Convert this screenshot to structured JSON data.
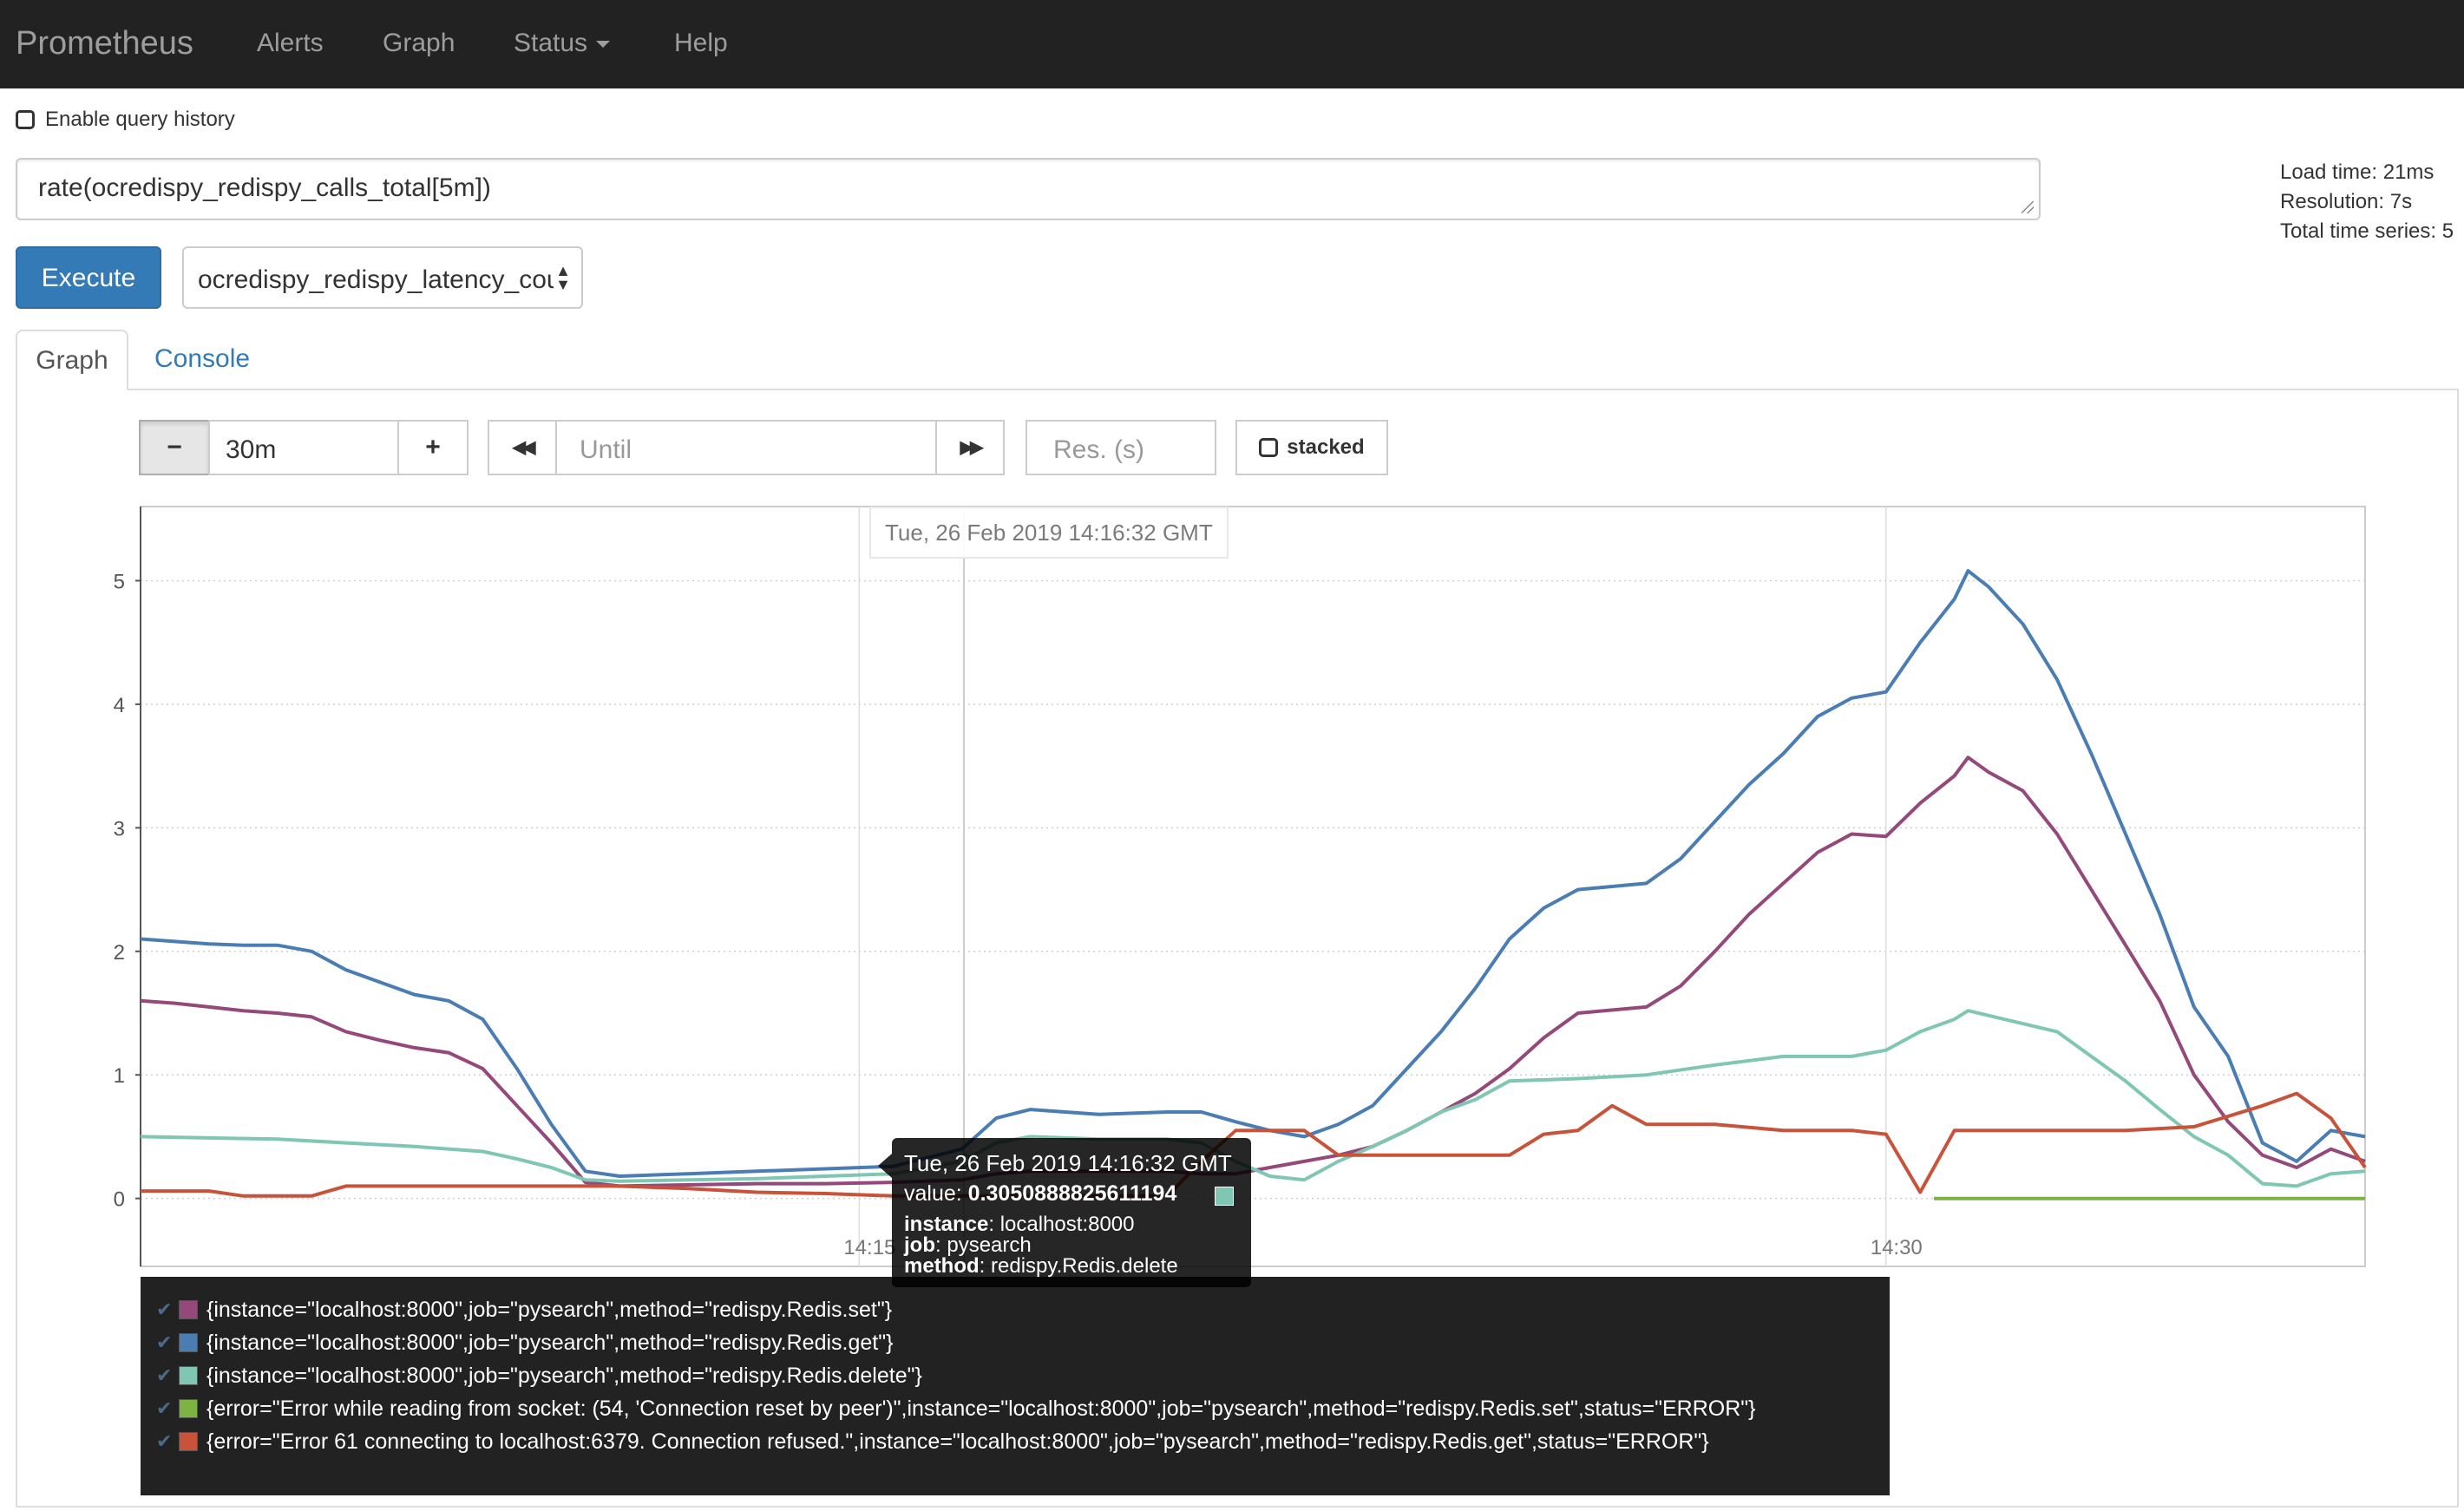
{
  "navbar": {
    "brand": "Prometheus",
    "links": [
      "Alerts",
      "Graph",
      "Status",
      "Help"
    ]
  },
  "query": {
    "history_label": "Enable query history",
    "expression": "rate(ocredispy_redispy_calls_total[5m])",
    "execute_label": "Execute",
    "metric_select_value": "ocredispy_redispy_latency_count"
  },
  "stats": {
    "load_time": "Load time: 21ms",
    "resolution": "Resolution: 7s",
    "total_series": "Total time series: 5"
  },
  "tabs": {
    "graph": "Graph",
    "console": "Console"
  },
  "controls": {
    "minus": "−",
    "range": "30m",
    "plus": "+",
    "back": "◀◀",
    "until_placeholder": "Until",
    "forward": "▶▶",
    "res_placeholder": "Res. (s)",
    "stacked_label": "stacked"
  },
  "hover_time_label": "Tue, 26 Feb 2019 14:16:32 GMT",
  "tooltip": {
    "time": "Tue, 26 Feb 2019 14:16:32 GMT",
    "value_label": "value:",
    "value": "0.3050888825611194",
    "instance_label": "instance",
    "instance": "localhost:8000",
    "job_label": "job",
    "job": "pysearch",
    "method_label": "method",
    "method": "redispy.Redis.delete"
  },
  "legend": [
    {
      "text": "{instance=\"localhost:8000\",job=\"pysearch\",method=\"redispy.Redis.set\"}",
      "color": "#94497a"
    },
    {
      "text": "{instance=\"localhost:8000\",job=\"pysearch\",method=\"redispy.Redis.get\"}",
      "color": "#4a7db3"
    },
    {
      "text": "{instance=\"localhost:8000\",job=\"pysearch\",method=\"redispy.Redis.delete\"}",
      "color": "#7fc6b3"
    },
    {
      "text": "{error=\"Error while reading from socket: (54, 'Connection reset by peer')\",instance=\"localhost:8000\",job=\"pysearch\",method=\"redispy.Redis.set\",status=\"ERROR\"}",
      "color": "#7cb342"
    },
    {
      "text": "{error=\"Error 61 connecting to localhost:6379. Connection refused.\",instance=\"localhost:8000\",job=\"pysearch\",method=\"redispy.Redis.get\",status=\"ERROR\"}",
      "color": "#c8533a"
    }
  ],
  "chart_data": {
    "type": "line",
    "title": "",
    "xlabel": "",
    "ylabel": "",
    "x_unit": "minutes since 14:04:30",
    "x_ticks": [
      {
        "x": 10.5,
        "label": "14:15"
      },
      {
        "x": 25.5,
        "label": "14:30"
      }
    ],
    "y_ticks": [
      0,
      1,
      2,
      3,
      4,
      5
    ],
    "xlim": [
      0,
      30
    ],
    "ylim": [
      -0.55,
      5.6
    ],
    "hover_x": 12.03,
    "grid": true,
    "series": [
      {
        "name": "{instance=\"localhost:8000\",job=\"pysearch\",method=\"redispy.Redis.set\"}",
        "color": "#94497a",
        "points": [
          [
            0,
            1.6
          ],
          [
            0.5,
            1.58
          ],
          [
            1,
            1.55
          ],
          [
            1.5,
            1.52
          ],
          [
            2,
            1.5
          ],
          [
            2.5,
            1.47
          ],
          [
            3,
            1.35
          ],
          [
            3.5,
            1.28
          ],
          [
            4,
            1.22
          ],
          [
            4.5,
            1.18
          ],
          [
            5,
            1.05
          ],
          [
            5.5,
            0.75
          ],
          [
            6,
            0.45
          ],
          [
            6.5,
            0.13
          ],
          [
            7,
            0.1
          ],
          [
            8,
            0.11
          ],
          [
            9,
            0.12
          ],
          [
            10,
            0.12
          ],
          [
            11,
            0.13
          ],
          [
            12,
            0.15
          ],
          [
            12.5,
            0.2
          ],
          [
            13,
            0.22
          ],
          [
            14,
            0.22
          ],
          [
            15,
            0.22
          ],
          [
            15.5,
            0.2
          ],
          [
            16,
            0.2
          ],
          [
            16.5,
            0.25
          ],
          [
            17,
            0.3
          ],
          [
            17.5,
            0.35
          ],
          [
            18,
            0.42
          ],
          [
            18.5,
            0.55
          ],
          [
            19,
            0.7
          ],
          [
            19.5,
            0.85
          ],
          [
            20,
            1.05
          ],
          [
            20.5,
            1.3
          ],
          [
            21,
            1.5
          ],
          [
            22,
            1.55
          ],
          [
            22.5,
            1.72
          ],
          [
            23,
            2.0
          ],
          [
            23.5,
            2.3
          ],
          [
            24,
            2.55
          ],
          [
            24.5,
            2.8
          ],
          [
            25,
            2.95
          ],
          [
            25.5,
            2.93
          ],
          [
            26,
            3.2
          ],
          [
            26.5,
            3.42
          ],
          [
            26.7,
            3.57
          ],
          [
            27,
            3.45
          ],
          [
            27.5,
            3.3
          ],
          [
            28,
            2.95
          ],
          [
            28.5,
            2.5
          ],
          [
            29,
            2.05
          ],
          [
            29.5,
            1.6
          ],
          [
            30,
            1.0
          ],
          [
            30.5,
            0.62
          ],
          [
            31,
            0.35
          ],
          [
            31.5,
            0.25
          ],
          [
            32,
            0.4
          ],
          [
            32.5,
            0.3
          ]
        ]
      },
      {
        "name": "{instance=\"localhost:8000\",job=\"pysearch\",method=\"redispy.Redis.get\"}",
        "color": "#4a7db3",
        "points": [
          [
            0,
            2.1
          ],
          [
            0.5,
            2.08
          ],
          [
            1,
            2.06
          ],
          [
            1.5,
            2.05
          ],
          [
            2,
            2.05
          ],
          [
            2.5,
            2.0
          ],
          [
            3,
            1.85
          ],
          [
            3.5,
            1.75
          ],
          [
            4,
            1.65
          ],
          [
            4.5,
            1.6
          ],
          [
            5,
            1.45
          ],
          [
            5.5,
            1.05
          ],
          [
            6,
            0.6
          ],
          [
            6.5,
            0.22
          ],
          [
            7,
            0.18
          ],
          [
            8,
            0.2
          ],
          [
            9,
            0.22
          ],
          [
            10,
            0.24
          ],
          [
            11,
            0.26
          ],
          [
            12,
            0.4
          ],
          [
            12.5,
            0.65
          ],
          [
            13,
            0.72
          ],
          [
            14,
            0.68
          ],
          [
            15,
            0.7
          ],
          [
            15.5,
            0.7
          ],
          [
            16,
            0.62
          ],
          [
            16.5,
            0.55
          ],
          [
            17,
            0.5
          ],
          [
            17.5,
            0.6
          ],
          [
            18,
            0.75
          ],
          [
            18.5,
            1.05
          ],
          [
            19,
            1.35
          ],
          [
            19.5,
            1.7
          ],
          [
            20,
            2.1
          ],
          [
            20.5,
            2.35
          ],
          [
            21,
            2.5
          ],
          [
            22,
            2.55
          ],
          [
            22.5,
            2.75
          ],
          [
            23,
            3.05
          ],
          [
            23.5,
            3.35
          ],
          [
            24,
            3.6
          ],
          [
            24.5,
            3.9
          ],
          [
            25,
            4.05
          ],
          [
            25.5,
            4.1
          ],
          [
            26,
            4.5
          ],
          [
            26.5,
            4.85
          ],
          [
            26.7,
            5.08
          ],
          [
            27,
            4.95
          ],
          [
            27.5,
            4.65
          ],
          [
            28,
            4.2
          ],
          [
            28.5,
            3.6
          ],
          [
            29,
            2.95
          ],
          [
            29.5,
            2.3
          ],
          [
            30,
            1.55
          ],
          [
            30.5,
            1.15
          ],
          [
            31,
            0.45
          ],
          [
            31.5,
            0.3
          ],
          [
            32,
            0.55
          ],
          [
            32.5,
            0.5
          ]
        ]
      },
      {
        "name": "{instance=\"localhost:8000\",job=\"pysearch\",method=\"redispy.Redis.delete\"}",
        "color": "#7fc6b3",
        "points": [
          [
            0,
            0.5
          ],
          [
            1,
            0.49
          ],
          [
            2,
            0.48
          ],
          [
            3,
            0.45
          ],
          [
            4,
            0.42
          ],
          [
            5,
            0.38
          ],
          [
            5.5,
            0.32
          ],
          [
            6,
            0.25
          ],
          [
            6.5,
            0.15
          ],
          [
            7,
            0.14
          ],
          [
            8,
            0.15
          ],
          [
            9,
            0.16
          ],
          [
            10,
            0.18
          ],
          [
            11,
            0.2
          ],
          [
            12,
            0.3
          ],
          [
            12.5,
            0.45
          ],
          [
            13,
            0.5
          ],
          [
            14,
            0.48
          ],
          [
            15,
            0.48
          ],
          [
            15.5,
            0.45
          ],
          [
            16,
            0.3
          ],
          [
            16.5,
            0.18
          ],
          [
            17,
            0.15
          ],
          [
            17.5,
            0.3
          ],
          [
            18,
            0.42
          ],
          [
            18.5,
            0.55
          ],
          [
            19,
            0.7
          ],
          [
            19.5,
            0.8
          ],
          [
            20,
            0.95
          ],
          [
            21,
            0.97
          ],
          [
            22,
            1.0
          ],
          [
            23,
            1.08
          ],
          [
            24,
            1.15
          ],
          [
            25,
            1.15
          ],
          [
            25.5,
            1.2
          ],
          [
            26,
            1.35
          ],
          [
            26.5,
            1.45
          ],
          [
            26.7,
            1.52
          ],
          [
            27,
            1.48
          ],
          [
            28,
            1.35
          ],
          [
            28.5,
            1.15
          ],
          [
            29,
            0.95
          ],
          [
            29.5,
            0.72
          ],
          [
            30,
            0.5
          ],
          [
            30.5,
            0.35
          ],
          [
            31,
            0.12
          ],
          [
            31.5,
            0.1
          ],
          [
            32,
            0.2
          ],
          [
            32.5,
            0.22
          ]
        ]
      },
      {
        "name": "{error=\"Error while reading from socket: (54, 'Connection reset by peer')\",instance=\"localhost:8000\",job=\"pysearch\",method=\"redispy.Redis.set\",status=\"ERROR\"}",
        "color": "#7cb342",
        "points": [
          [
            26.2,
            0
          ],
          [
            32.5,
            0
          ]
        ]
      },
      {
        "name": "{error=\"Error 61 connecting to localhost:6379. Connection refused.\",instance=\"localhost:8000\",job=\"pysearch\",method=\"redispy.Redis.get\",status=\"ERROR\"}",
        "color": "#c8533a",
        "points": [
          [
            0,
            0.06
          ],
          [
            1,
            0.06
          ],
          [
            1.5,
            0.02
          ],
          [
            2.5,
            0.02
          ],
          [
            3,
            0.1
          ],
          [
            4,
            0.1
          ],
          [
            5,
            0.1
          ],
          [
            6,
            0.1
          ],
          [
            7,
            0.1
          ],
          [
            8,
            0.08
          ],
          [
            9,
            0.05
          ],
          [
            10,
            0.04
          ],
          [
            11,
            0.02
          ],
          [
            12,
            0.02
          ],
          [
            13,
            0.02
          ],
          [
            14,
            0.02
          ],
          [
            15,
            0.02
          ],
          [
            15.5,
            0.3
          ],
          [
            16,
            0.55
          ],
          [
            17,
            0.55
          ],
          [
            17.5,
            0.35
          ],
          [
            18,
            0.35
          ],
          [
            19,
            0.35
          ],
          [
            20,
            0.35
          ],
          [
            20.5,
            0.52
          ],
          [
            21,
            0.55
          ],
          [
            21.5,
            0.75
          ],
          [
            22,
            0.6
          ],
          [
            23,
            0.6
          ],
          [
            24,
            0.55
          ],
          [
            25,
            0.55
          ],
          [
            25.5,
            0.52
          ],
          [
            26,
            0.05
          ],
          [
            26.5,
            0.55
          ],
          [
            27,
            0.55
          ],
          [
            28,
            0.55
          ],
          [
            29,
            0.55
          ],
          [
            30,
            0.58
          ],
          [
            31,
            0.75
          ],
          [
            31.5,
            0.85
          ],
          [
            32,
            0.65
          ],
          [
            32.5,
            0.25
          ]
        ]
      }
    ]
  }
}
